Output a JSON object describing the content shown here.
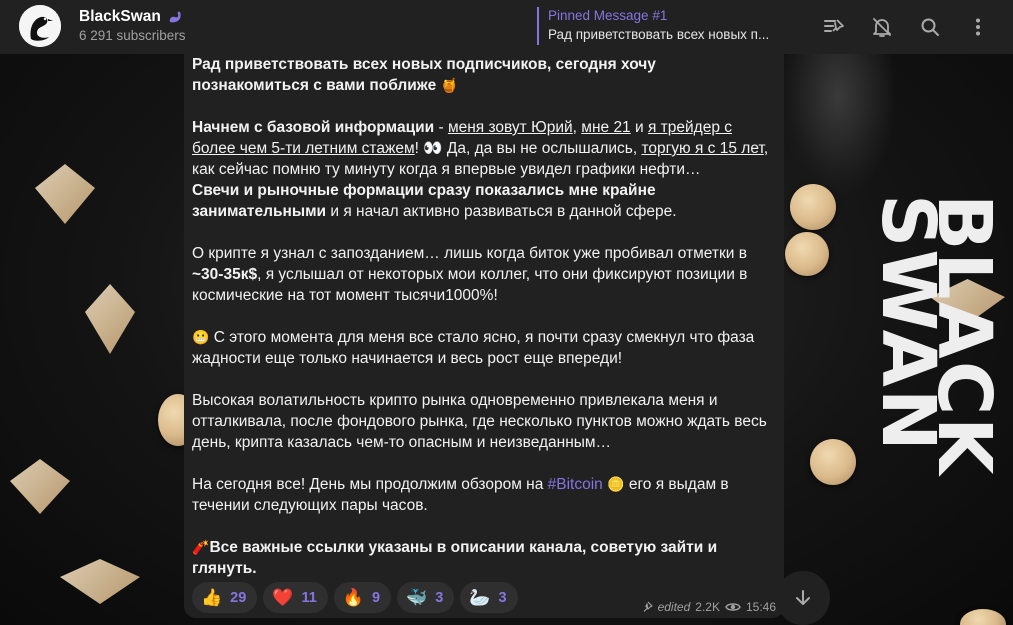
{
  "header": {
    "title": "BlackSwan",
    "subscribers": "6 291 subscribers",
    "pinned_title": "Pinned Message #1",
    "pinned_text": "Рад приветствовать всех новых п..."
  },
  "icons": {
    "header_buttons": [
      "pinned-list-icon",
      "mute-bell-icon",
      "search-icon",
      "more-vertical-icon"
    ],
    "title_badge": "swan-icon",
    "scroll": "arrow-down-icon"
  },
  "message": {
    "p1": "Рад приветствовать всех новых подписчиков, сегодня хочу познакомиться с вами поближе",
    "p2_b1": "Начнем с базовой информации",
    "p2_t1": " - ",
    "p2_u1": "меня зовут Юрий",
    "p2_t2": ", ",
    "p2_u2": "мне 21",
    "p2_t3": " и ",
    "p2_u3": "я трейдер с более чем 5-ти летним стажем",
    "p2_t4": "! 👀 Да, да вы не ослышались, ",
    "p2_u4": "торгую я с 15 лет",
    "p2_t5": ", как сейчас помню ту минуту когда я впервые увидел графики нефти…",
    "p2_b2": "Свечи и рыночные формации сразу показались мне крайне занимательными",
    "p2_t6": " и я начал активно развиваться в данной сфере.",
    "p3_t1": "О крипте я узнал с запозданием… лишь когда биток уже пробивал отметки в ",
    "p3_b1": "~30-35к$",
    "p3_t2": ", я услышал от некоторых мои коллег, что они фиксируют позиции в космические на тот момент тысячи1000%!",
    "p4": "С этого момента для меня все стало ясно, я почти сразу смекнул что фаза жадности еще только начинается и весь рост еще впереди!",
    "p5": "Высокая волатильность крипто рынка одновременно привлекала меня и отталкивала, после фондового рынка, где несколько пунктов можно ждать весь день, крипта казалась чем-то опасным и неизведанным…",
    "p6_t1": "На сегодня все! День мы продолжим обзором на ",
    "p6_tag": "#Bitcoin",
    "p6_t2": " его я выдам в течении следующих пары часов.",
    "p7": "Все важные ссылки указаны в описании канала, советую зайти и глянуть."
  },
  "reactions": [
    {
      "emoji": "👍",
      "count": "29"
    },
    {
      "emoji": "❤️",
      "count": "11"
    },
    {
      "emoji": "🔥",
      "count": "9"
    },
    {
      "emoji": "🐳",
      "count": "3"
    },
    {
      "emoji": "🦢",
      "count": "3"
    }
  ],
  "meta": {
    "edited": "edited",
    "views": "2.2K",
    "time": "15:46"
  },
  "background_text": "BLACK SWAN",
  "colors": {
    "accent": "#8774e1",
    "panel": "#212121",
    "reaction_bg": "#2f2f2f"
  }
}
